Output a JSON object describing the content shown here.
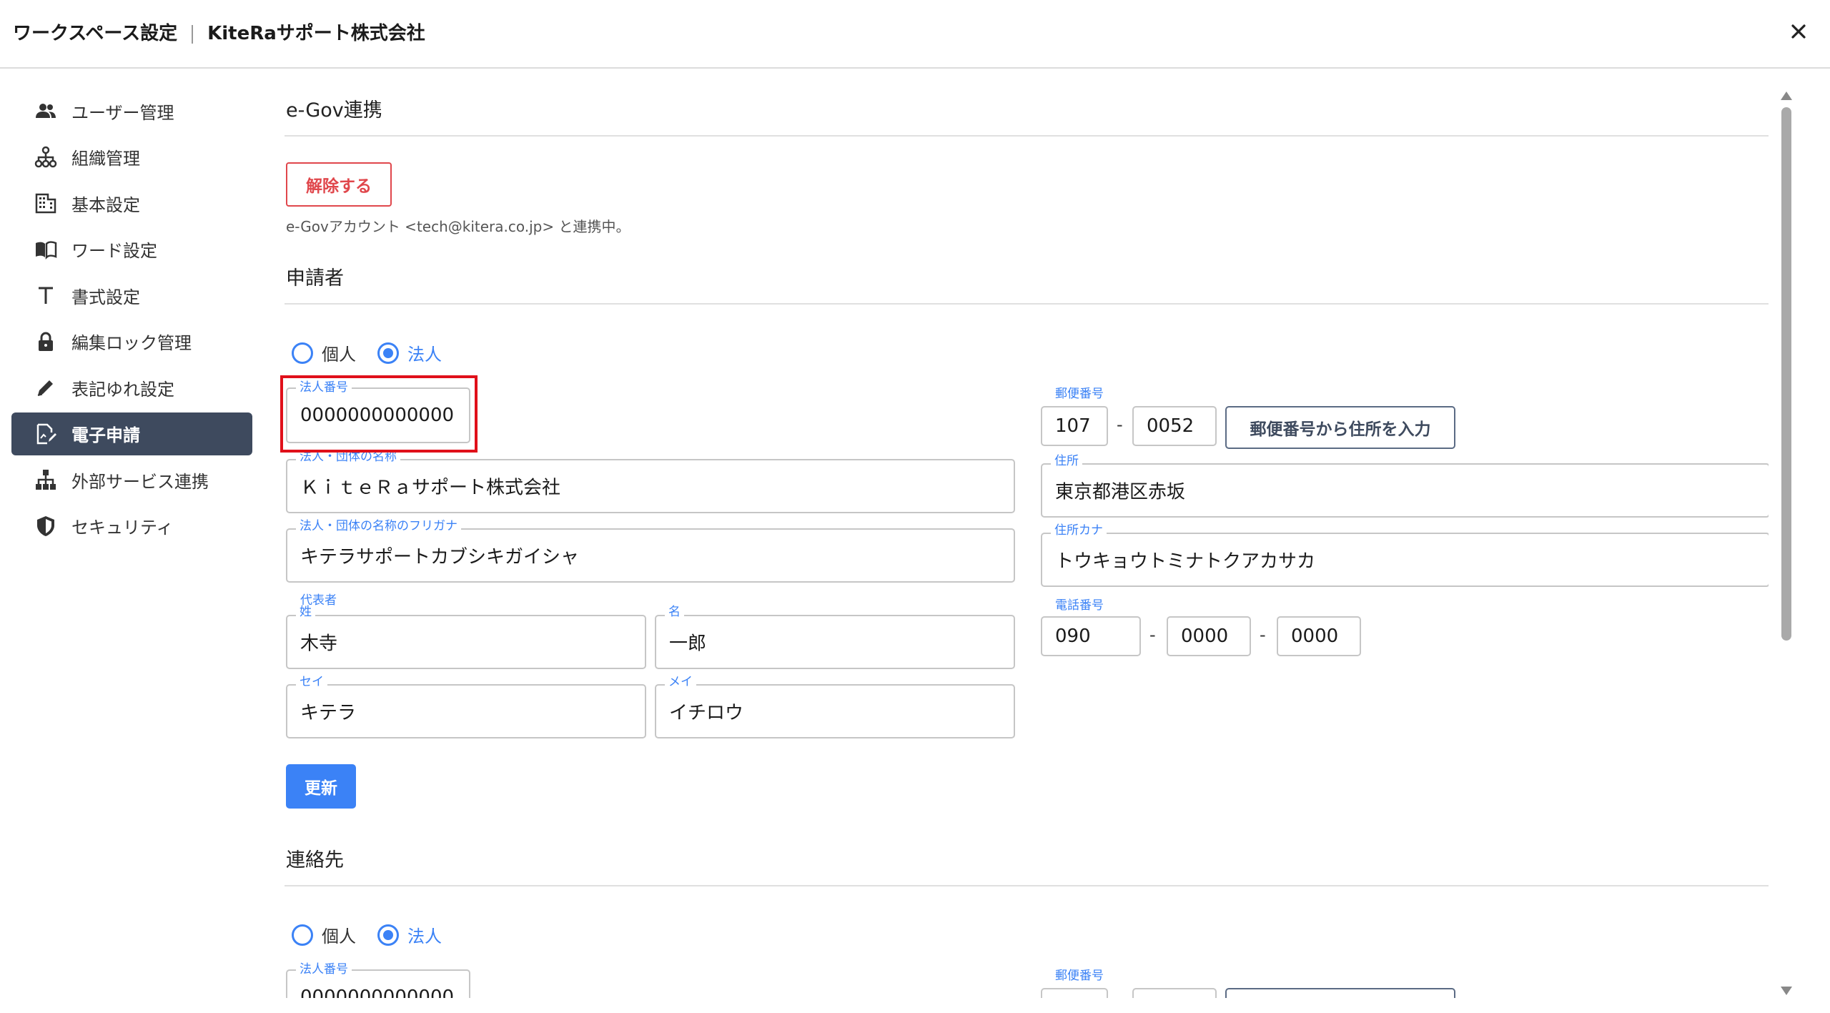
{
  "header": {
    "title": "ワークスペース設定",
    "org": "KiteRaサポート株式会社",
    "close_icon": "close-icon"
  },
  "sidebar": {
    "items": [
      {
        "label": "ユーザー管理",
        "icon": "users-icon"
      },
      {
        "label": "組織管理",
        "icon": "org-chart-icon"
      },
      {
        "label": "基本設定",
        "icon": "building-icon"
      },
      {
        "label": "ワード設定",
        "icon": "book-icon"
      },
      {
        "label": "書式設定",
        "icon": "text-format-icon"
      },
      {
        "label": "編集ロック管理",
        "icon": "lock-icon"
      },
      {
        "label": "表記ゆれ設定",
        "icon": "pencil-icon"
      },
      {
        "label": "電子申請",
        "icon": "e-application-icon",
        "active": true
      },
      {
        "label": "外部サービス連携",
        "icon": "sitemap-icon"
      },
      {
        "label": "セキュリティ",
        "icon": "shield-icon"
      }
    ]
  },
  "egov": {
    "title": "e-Gov連携",
    "disconnect_label": "解除する",
    "status_text": "e-Govアカウント <tech@kitera.co.jp> と連携中。"
  },
  "applicant": {
    "title": "申請者",
    "radio_individual": "個人",
    "radio_corporate": "法人",
    "selected": "法人",
    "corp_number_label": "法人番号",
    "corp_number_value": "0000000000000",
    "corp_name_label": "法人・団体の名称",
    "corp_name_value": "ＫｉｔｅＲａサポート株式会社",
    "corp_kana_label": "法人・団体の名称のフリガナ",
    "corp_kana_value": "キテラサポートカブシキガイシャ",
    "rep_label": "代表者",
    "last_name_label": "姓",
    "last_name_value": "木寺",
    "first_name_label": "名",
    "first_name_value": "一郎",
    "last_kana_label": "セイ",
    "last_kana_value": "キテラ",
    "first_kana_label": "メイ",
    "first_kana_value": "イチロウ",
    "postal_label": "郵便番号",
    "postal1": "107",
    "postal2": "0052",
    "postal_dash": "-",
    "address_lookup_label": "郵便番号から住所を入力",
    "address_label": "住所",
    "address_value": "東京都港区赤坂",
    "address_kana_label": "住所カナ",
    "address_kana_value": "トウキョウトミナトクアカサカ",
    "phone_label": "電話番号",
    "phone1": "090",
    "phone2": "0000",
    "phone3": "0000",
    "phone_dash": "-",
    "update_label": "更新"
  },
  "contact": {
    "title": "連絡先",
    "radio_individual": "個人",
    "radio_corporate": "法人",
    "selected": "法人",
    "corp_number_label": "法人番号",
    "corp_number_value": "0000000000000",
    "postal_label": "郵便番号"
  },
  "colors": {
    "accent": "#3b82f6",
    "danger": "#e0474c",
    "sidebar_active": "#3e4a5e",
    "highlight": "#e0101a"
  }
}
